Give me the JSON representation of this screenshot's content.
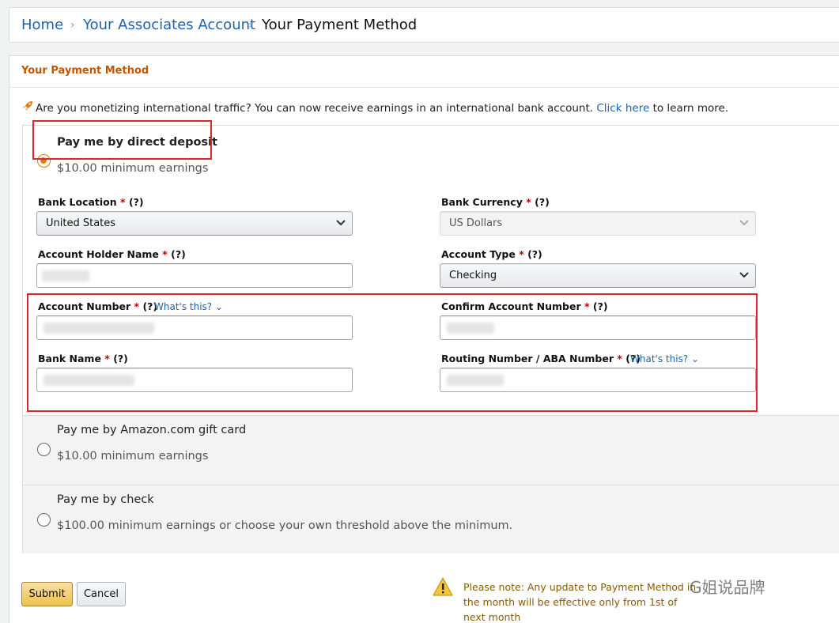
{
  "breadcrumb": {
    "home": "Home",
    "account": "Your Associates Account",
    "current": "Your Payment Method",
    "separator": "›"
  },
  "panel": {
    "title": "Your Payment Method"
  },
  "notice": {
    "text": "Are you monetizing international traffic? You can now receive earnings in an international bank account.",
    "link": "Click here",
    "suffix": "to learn more."
  },
  "options": {
    "direct_deposit": {
      "title": "Pay me by direct deposit",
      "subtitle": "$10.00 minimum earnings",
      "selected": true
    },
    "gift_card": {
      "title": "Pay me by Amazon.com gift card",
      "subtitle": "$10.00 minimum earnings",
      "selected": false
    },
    "check": {
      "title": "Pay me by check",
      "subtitle": "$100.00 minimum earnings or choose your own threshold above the minimum.",
      "selected": false
    }
  },
  "form": {
    "required_mark": "*",
    "help_mark": "(?)",
    "whats_this": "What's this?",
    "bank_location": {
      "label": "Bank Location",
      "value": "United States"
    },
    "bank_currency": {
      "label": "Bank Currency",
      "value": "US Dollars"
    },
    "account_holder": {
      "label": "Account Holder Name"
    },
    "account_type": {
      "label": "Account Type",
      "value": "Checking"
    },
    "account_number": {
      "label": "Account Number"
    },
    "confirm_account_number": {
      "label": "Confirm Account Number"
    },
    "bank_name": {
      "label": "Bank Name"
    },
    "routing_number": {
      "label": "Routing Number / ABA Number"
    }
  },
  "actions": {
    "submit": "Submit",
    "cancel": "Cancel"
  },
  "note": "Please note: Any update to Payment Method in the month will be effective only from 1st of next month",
  "watermark": "G姐说品牌",
  "colors": {
    "link": "#1f62ad",
    "panel_title": "#c45500",
    "radio_selected": "#e47911",
    "highlight_box": "#e0262a",
    "required": "#c40000",
    "submit_button": "#f0c14b"
  },
  "icons": {
    "notice": "rocket-icon",
    "select": "chevron-down-icon",
    "warning": "warning-triangle-icon"
  }
}
